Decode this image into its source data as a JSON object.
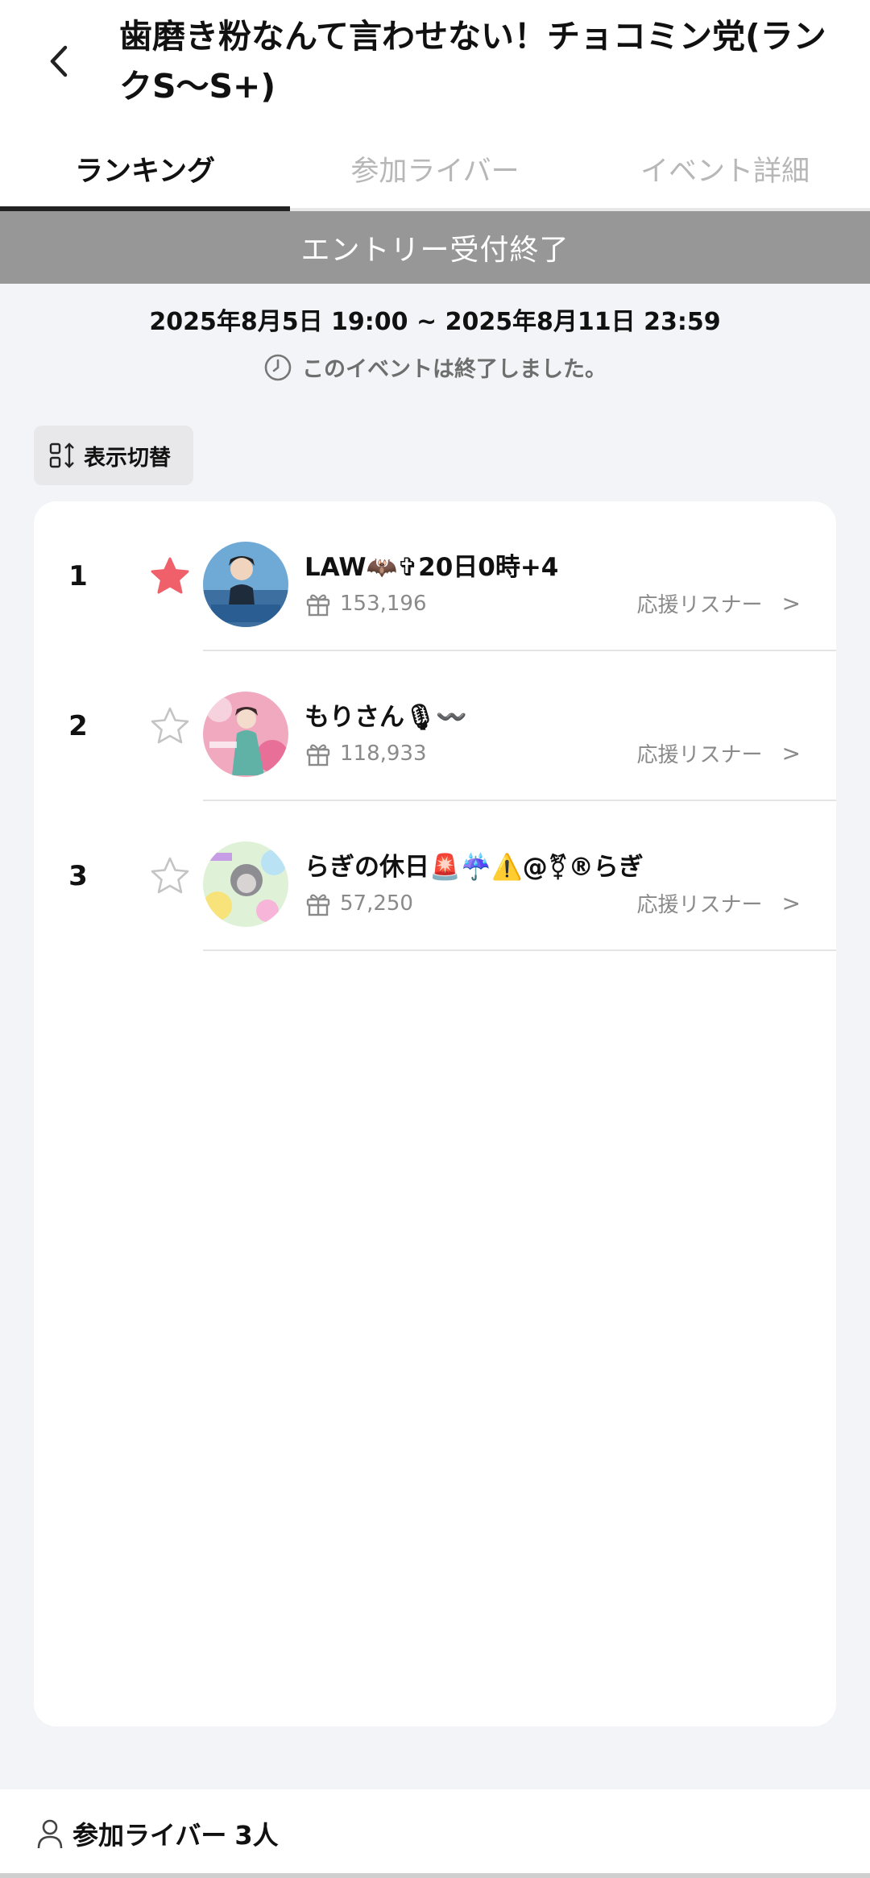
{
  "header": {
    "title": "歯磨き粉なんて言わせない！チョコミン党(ランクS〜S+)",
    "back_icon": "chevron-left-icon"
  },
  "tabs": [
    {
      "label": "ランキング",
      "active": true
    },
    {
      "label": "参加ライバー",
      "active": false
    },
    {
      "label": "イベント詳細",
      "active": false
    }
  ],
  "banner": "エントリー受付終了",
  "event": {
    "period": "2025年8月5日 19:00 ~ 2025年8月11日 23:59",
    "status": "このイベントは終了しました。",
    "status_icon": "clock-icon"
  },
  "switch_button": {
    "label": "表示切替",
    "icon": "sort-toggle-icon"
  },
  "ranking": [
    {
      "rank": "1",
      "name": "LAW🦇✞20日0時+4",
      "score": "153,196",
      "support": "応援リスナー",
      "starred": true
    },
    {
      "rank": "2",
      "name": "もりさん🎙〰️",
      "score": "118,933",
      "support": "応援リスナー",
      "starred": false
    },
    {
      "rank": "3",
      "name": "らぎの休日🚨☔️⚠️@⚧®らぎ",
      "score": "57,250",
      "support": "応援リスナー",
      "starred": false
    }
  ],
  "chevron": ">",
  "footer": {
    "label": "参加ライバー",
    "count": "3人",
    "icon": "person-icon"
  },
  "colors": {
    "star_active": "#f0606a",
    "banner_bg": "#979797",
    "page_bg": "#f3f4f7"
  }
}
